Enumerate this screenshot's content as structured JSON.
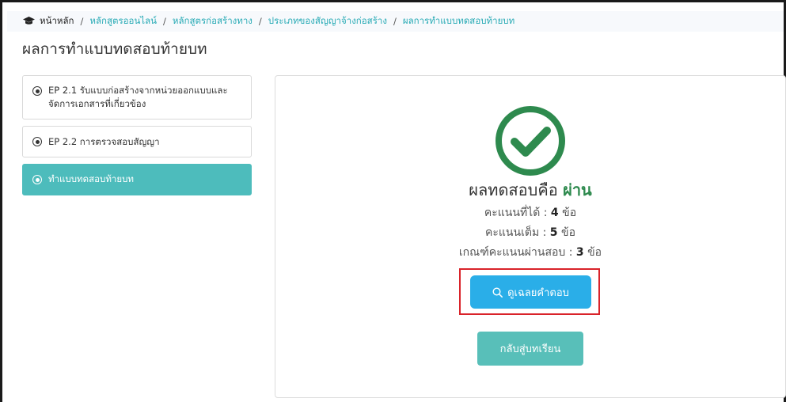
{
  "breadcrumb": {
    "home": "หน้าหลัก",
    "separator": "/",
    "items": [
      "หลักสูตรออนไลน์",
      "หลักสูตรก่อสร้างทาง",
      "ประเภทของสัญญาจ้างก่อสร้าง",
      "ผลการทำแบบทดสอบท้ายบท"
    ],
    "home_icon": "graduation-cap-icon"
  },
  "page_title": "ผลการทำแบบทดสอบท้ายบท",
  "sidebar": {
    "items": [
      {
        "label": "EP 2.1 รับแบบก่อสร้างจากหน่วยออกแบบและจัดการเอกสารที่เกี่ยวข้อง",
        "active": false
      },
      {
        "label": "EP 2.2 การตรวจสอบสัญญา",
        "active": false
      },
      {
        "label": "ทำแบบทดสอบท้ายบท",
        "active": true
      }
    ]
  },
  "result": {
    "icon": "check-circle-icon",
    "heading": "ผลทดสอบคือ",
    "status": "ผ่าน",
    "score_label": "คะแนนที่ได้ :",
    "score_value": "4",
    "score_unit": "ข้อ",
    "full_label": "คะแนนเต็ม :",
    "full_value": "5",
    "full_unit": "ข้อ",
    "pass_label": "เกณฑ์คะแนนผ่านสอบ :",
    "pass_value": "3",
    "pass_unit": "ข้อ",
    "view_answers_label": "ดูเฉลยคำตอบ",
    "back_label": "กลับสู่บทเรียน"
  },
  "colors": {
    "accent_teal": "#4dbcbc",
    "link": "#27aab5",
    "success": "#2e8a4e",
    "primary_button": "#2aaee8",
    "highlight": "#d9232a"
  }
}
